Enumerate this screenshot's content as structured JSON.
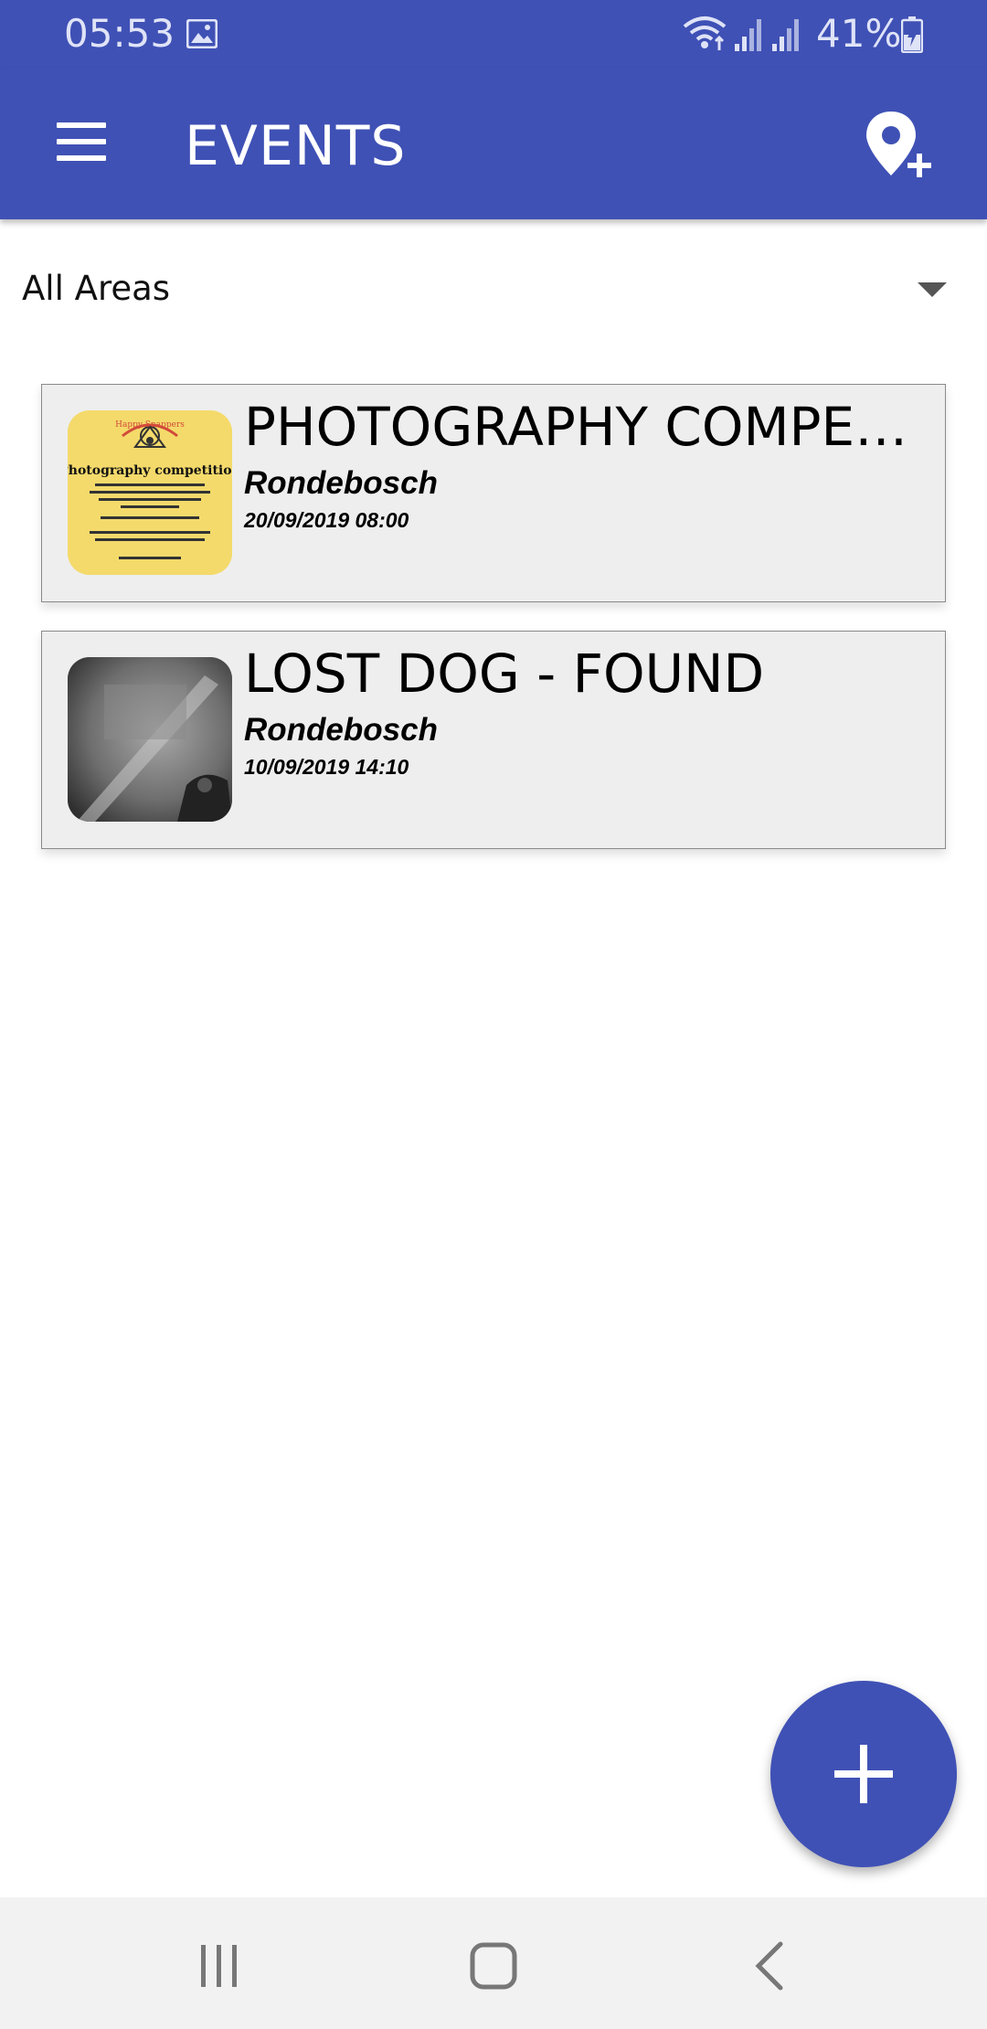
{
  "status_bar": {
    "time": "05:53",
    "battery_percent": "41%",
    "icons": [
      "image-icon",
      "wifi-icon",
      "signal-icon",
      "signal-icon",
      "battery-charging-icon"
    ]
  },
  "app_bar": {
    "title": "EVENTS",
    "menu_icon": "menu-icon",
    "action_icon": "add-location-icon"
  },
  "filter": {
    "selected": "All Areas",
    "icon": "dropdown-arrow-icon"
  },
  "events": [
    {
      "title": "PHOTOGRAPHY COMPETITION",
      "area": "Rondebosch",
      "date": "20/09/2019 08:00",
      "thumbnail": {
        "kind": "poster",
        "background": "#f4da6b",
        "poster_heading": "Photography competition",
        "poster_brand": "Happy Snappers"
      }
    },
    {
      "title": "LOST DOG - FOUND",
      "area": "Rondebosch",
      "date": "10/09/2019 14:10",
      "thumbnail": {
        "kind": "photo",
        "background": "#6d6d6d"
      }
    }
  ],
  "fab": {
    "icon": "plus-icon"
  },
  "nav_bar": {
    "icons": [
      "recent-apps-icon",
      "home-icon",
      "back-icon"
    ]
  },
  "colors": {
    "primary": "#3f51b5",
    "card_background": "#eeeeee",
    "nav_background": "#f2f2f2"
  }
}
